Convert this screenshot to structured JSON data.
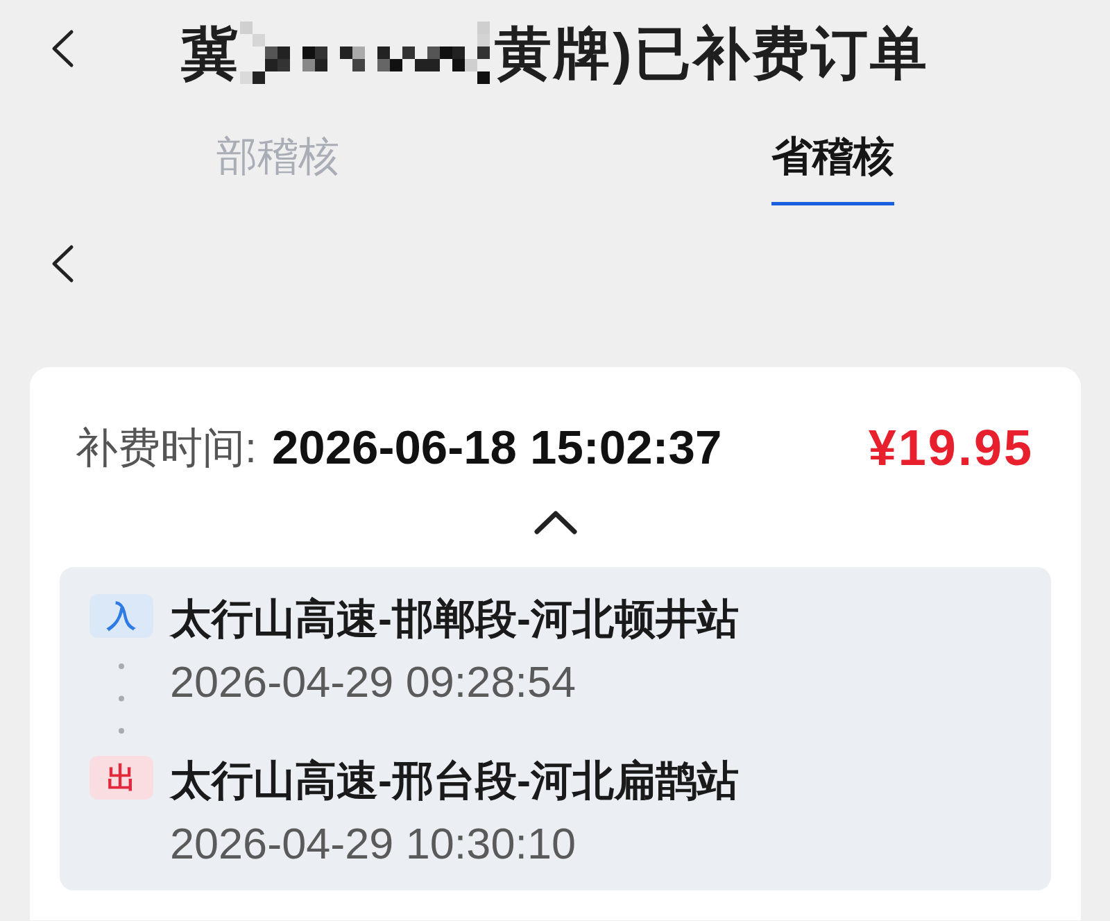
{
  "header": {
    "title": {
      "prefix": "冀",
      "redacted": true,
      "suffix": "黄牌)已补费订单"
    }
  },
  "tabs": [
    {
      "label": "部稽核",
      "selected": false
    },
    {
      "label": "省稽核",
      "selected": true
    }
  ],
  "order": {
    "time_label": "补费时间:",
    "time": "2026-06-18 15:02:37",
    "amount": "¥19.95",
    "expanded": true,
    "stops": [
      {
        "kind": "entry",
        "badge": "入",
        "station": "太行山高速-邯郸段-河北顿井站",
        "time": "2026-04-29 09:28:54"
      },
      {
        "kind": "exit",
        "badge": "出",
        "station": "太行山高速-邢台段-河北扁鹊站",
        "time": "2026-04-29 10:30:10"
      }
    ]
  }
}
